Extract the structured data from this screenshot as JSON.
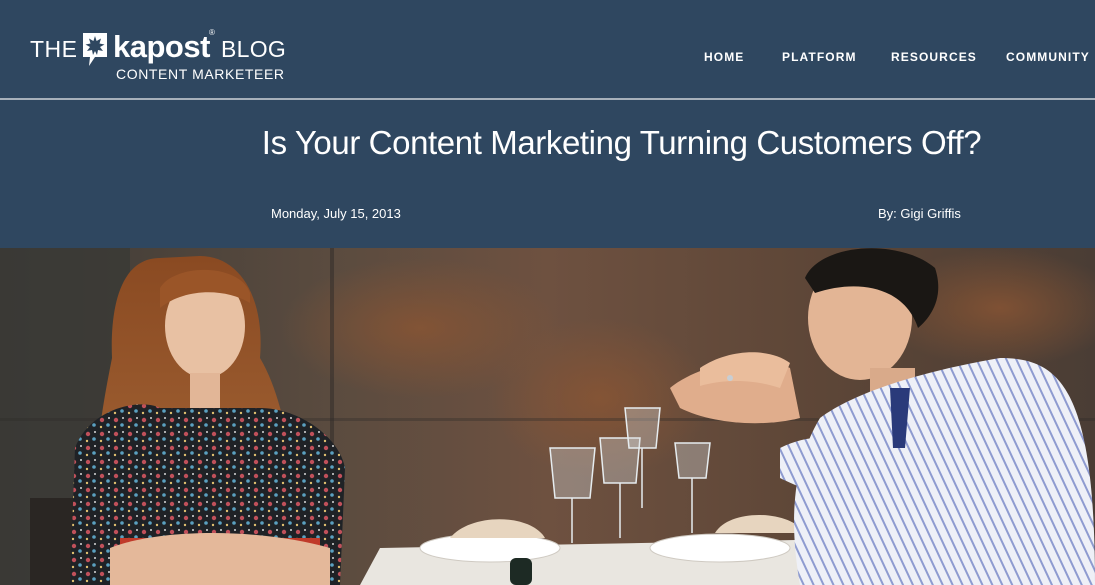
{
  "header": {
    "logo": {
      "prefix": "THE",
      "brand": "kapost",
      "registered": "®",
      "suffix": "BLOG",
      "tagline": "CONTENT MARKETEER"
    },
    "nav": [
      {
        "label": "HOME"
      },
      {
        "label": "PLATFORM"
      },
      {
        "label": "RESOURCES"
      },
      {
        "label": "COMMUNITY"
      }
    ]
  },
  "post": {
    "title": "Is Your Content Marketing Turning Customers Off?",
    "date": "Monday, July 15, 2013",
    "author": "By: Gigi Griffis"
  },
  "colors": {
    "header_bg": "#2f4760",
    "rule": "#a7b0ba",
    "text": "#ffffff"
  }
}
